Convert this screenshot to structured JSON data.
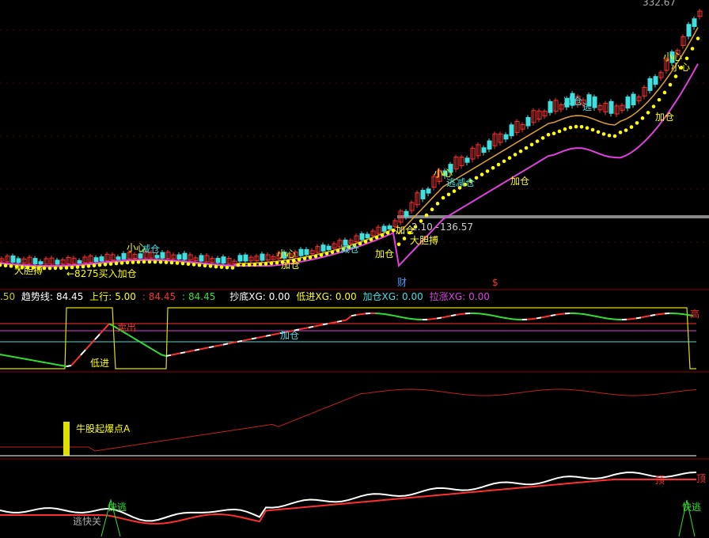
{
  "chart_data": [
    {
      "type": "candlestick",
      "price_top_label": "332.67",
      "price_label_right": "136.57",
      "price_label_left_partial": "2.10 -",
      "markers_top": {
        "cai": "财",
        "s": "$"
      },
      "annotations": [
        "大胆搏",
        "←8275买入加仓",
        "小心",
        "减仓",
        "加仓",
        "加仓",
        "小心",
        "减仓",
        "大胆搏",
        "加仓",
        "小心",
        "逃减仓",
        "加仓",
        "减仓",
        "逃",
        "加仓",
        "小心",
        "小心"
      ],
      "series": [
        {
          "name": "MA short",
          "color": "#e0a030"
        },
        {
          "name": "MA dotted",
          "color": "#ffff00"
        },
        {
          "name": "MA long",
          "color": "#e040e0"
        }
      ],
      "gray_line_price_note": "horizontal reference line"
    },
    {
      "type": "line",
      "legend": {
        "prev_value": ".50",
        "trend_label": "趋势线:",
        "trend_value": "84.45",
        "up_label": "上行:",
        "up_value": "5.00",
        "red_label": ":",
        "red_value": "84.45",
        "green_label": ":",
        "green_value": "84.45",
        "xg1_label": "抄底XG:",
        "xg1_value": "0.00",
        "xg2_label": "低进XG:",
        "xg2_value": "0.00",
        "xg3_label": "加仓XG:",
        "xg3_value": "0.00",
        "xg4_label": "拉涨XG:",
        "xg4_value": "0.00"
      },
      "labels": [
        "低进",
        "卖出",
        "加仓",
        "高"
      ],
      "count_labels": [
        "5",
        "6",
        "7",
        "8",
        "9",
        "1",
        "2",
        "3",
        "4",
        "5",
        "6",
        "7",
        "8",
        "9"
      ]
    },
    {
      "type": "line",
      "labels": [
        "牛股起爆点A"
      ]
    },
    {
      "type": "line",
      "labels": [
        "快逃",
        "逃快关",
        "快逃",
        "顶",
        "顶"
      ]
    }
  ],
  "colors": {
    "up": "#ff3030",
    "down": "#40e0e0",
    "ma_short": "#e0a030",
    "ma_dot": "#ffff00",
    "ma_long": "#e040e0",
    "grid": "#8b0000",
    "green": "#30e030",
    "white": "#ffffff",
    "cyan": "#40e0e0"
  }
}
